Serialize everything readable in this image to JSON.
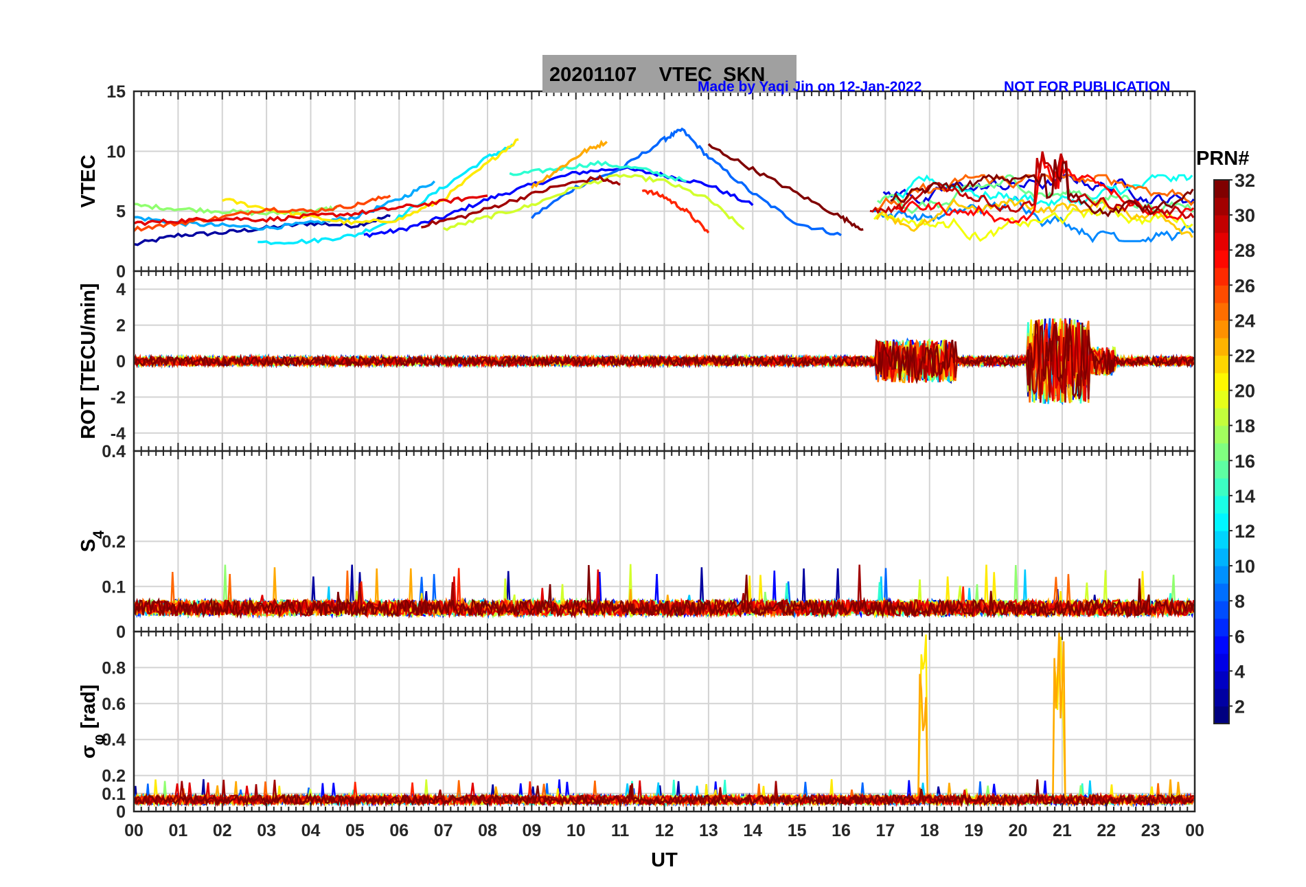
{
  "header": {
    "title": "20201107    VTEC  SKN",
    "credit_left": "Made by Yaqi Jin on 12-Jan-2022",
    "credit_right": "NOT FOR PUBLICATION",
    "credit_color": "#0000ff"
  },
  "x_axis": {
    "label": "UT",
    "range": [
      0,
      24
    ],
    "ticks": [
      "00",
      "01",
      "02",
      "03",
      "04",
      "05",
      "06",
      "07",
      "08",
      "09",
      "10",
      "11",
      "12",
      "13",
      "14",
      "15",
      "16",
      "17",
      "18",
      "19",
      "20",
      "21",
      "22",
      "23",
      "00"
    ]
  },
  "colorbar": {
    "label": "PRN#",
    "range": [
      1,
      32
    ],
    "colormap": "jet",
    "ticks": [
      "2",
      "4",
      "6",
      "8",
      "10",
      "12",
      "14",
      "16",
      "18",
      "20",
      "22",
      "24",
      "26",
      "28",
      "30",
      "32"
    ]
  },
  "chart_data": [
    {
      "type": "line",
      "panel": "VTEC",
      "ylabel": "VTEC",
      "ylim": [
        0,
        15
      ],
      "yticks": [
        "0",
        "5",
        "10",
        "15"
      ],
      "grid": true,
      "series": [
        {
          "prn": 2,
          "x": [
            0.0,
            1.0,
            2.0,
            3.0,
            4.0,
            5.0,
            5.8
          ],
          "values": [
            2.2,
            3.0,
            3.2,
            3.6,
            4.0,
            3.8,
            4.6
          ]
        },
        {
          "prn": 5,
          "x": [
            5.2,
            6.0,
            7.0,
            8.0,
            9.0,
            10.0,
            11.0,
            12.0,
            13.0,
            14.0
          ],
          "values": [
            3.0,
            3.4,
            4.5,
            6.0,
            7.2,
            8.2,
            8.6,
            8.0,
            7.2,
            5.5
          ]
        },
        {
          "prn": 8,
          "x": [
            9.0,
            10.0,
            11.0,
            12.0,
            12.4,
            13.0,
            14.0,
            15.0,
            16.0
          ],
          "values": [
            4.5,
            7.0,
            8.5,
            11.0,
            11.8,
            9.5,
            6.5,
            4.0,
            3.0
          ]
        },
        {
          "prn": 10,
          "x": [
            0.0,
            1.0,
            2.0,
            3.0,
            4.0,
            5.0,
            6.0,
            6.8
          ],
          "values": [
            4.5,
            4.0,
            3.8,
            3.6,
            4.0,
            4.5,
            6.0,
            7.5
          ]
        },
        {
          "prn": 12,
          "x": [
            2.8,
            4.0,
            5.0,
            6.0,
            7.0,
            8.0,
            8.6
          ],
          "values": [
            2.4,
            2.5,
            3.0,
            4.5,
            7.0,
            9.5,
            10.5
          ]
        },
        {
          "prn": 14,
          "x": [
            8.5,
            9.5,
            10.5,
            11.5,
            12.5
          ],
          "values": [
            8.0,
            8.5,
            9.0,
            8.5,
            7.5
          ]
        },
        {
          "prn": 17,
          "x": [
            0.0,
            1.0,
            2.0,
            3.0,
            4.0,
            4.6
          ],
          "values": [
            5.5,
            5.2,
            5.0,
            4.8,
            5.0,
            5.3
          ]
        },
        {
          "prn": 19,
          "x": [
            7.0,
            8.0,
            9.0,
            10.0,
            11.0,
            12.0,
            13.0,
            13.8
          ],
          "values": [
            3.5,
            4.5,
            5.5,
            7.0,
            8.0,
            7.5,
            6.0,
            3.5
          ]
        },
        {
          "prn": 21,
          "x": [
            2.0,
            3.0,
            4.0,
            5.0,
            6.0,
            7.0,
            8.0,
            8.7
          ],
          "values": [
            6.0,
            5.2,
            4.5,
            4.0,
            4.3,
            6.0,
            9.0,
            11.0
          ]
        },
        {
          "prn": 23,
          "x": [
            9.0,
            9.6,
            10.2,
            10.7
          ],
          "values": [
            7.0,
            8.5,
            10.0,
            10.8
          ]
        },
        {
          "prn": 26,
          "x": [
            0.0,
            1.0,
            2.0,
            3.0,
            4.0,
            5.0,
            5.8
          ],
          "values": [
            3.5,
            4.0,
            4.5,
            5.2,
            5.0,
            5.5,
            6.3
          ]
        },
        {
          "prn": 27,
          "x": [
            11.5,
            12.0,
            12.5,
            13.0
          ],
          "values": [
            6.8,
            6.2,
            5.0,
            3.2
          ]
        },
        {
          "prn": 29,
          "x": [
            0.0,
            1.0,
            2.0,
            3.0,
            4.0,
            5.0,
            6.0,
            7.0,
            8.0
          ],
          "values": [
            4.0,
            4.2,
            4.4,
            4.3,
            4.6,
            4.8,
            5.3,
            5.8,
            6.3
          ]
        },
        {
          "prn": 31,
          "x": [
            6.5,
            7.5,
            8.5,
            9.5,
            10.5,
            11.0
          ],
          "values": [
            3.8,
            4.6,
            5.8,
            7.0,
            7.8,
            7.2
          ]
        },
        {
          "prn": 32,
          "x": [
            13.0,
            14.0,
            15.0,
            16.0,
            16.5
          ],
          "values": [
            10.5,
            8.5,
            6.5,
            4.5,
            3.5
          ]
        }
      ]
    },
    {
      "type": "line",
      "panel": "ROT",
      "ylabel": "ROT [TECU/min]",
      "ylim": [
        -5,
        5
      ],
      "yticks": [
        "-4",
        "-2",
        "0",
        "2",
        "4"
      ],
      "grid": true
    },
    {
      "type": "line",
      "panel": "S4",
      "ylabel": "S",
      "ylabel_sub": "4",
      "ylim": [
        0,
        0.4
      ],
      "yticks": [
        "0",
        "0.1",
        "0.2",
        "0.4"
      ],
      "grid": true
    },
    {
      "type": "line",
      "panel": "sigma_phi",
      "ylabel": "σ",
      "ylabel_sub": "φ",
      "ylabel_suffix": " [rad]",
      "ylim": [
        0,
        1
      ],
      "yticks": [
        "0",
        "0.1",
        "0.2",
        "0.4",
        "0.6",
        "0.8"
      ],
      "grid": true
    }
  ]
}
